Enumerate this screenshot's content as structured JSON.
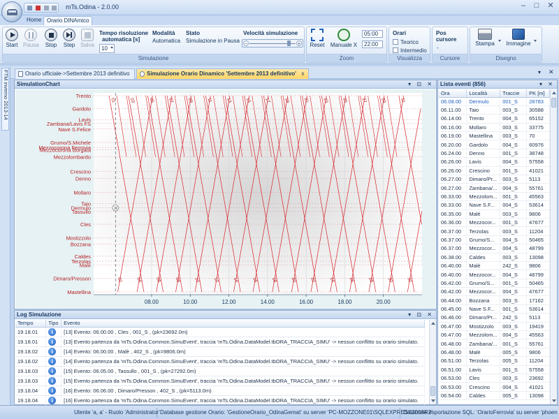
{
  "window": {
    "title": "mTs.Odina - 2.0.00",
    "minimize": "–",
    "maximize": "□",
    "close": "✕"
  },
  "ribbon_tabs": [
    {
      "label": "Home"
    },
    {
      "label": "Orario DINAmico"
    }
  ],
  "ribbon": {
    "simulazione": {
      "title": "Simulazione",
      "start": "Start",
      "pausa": "Pausa",
      "stop": "Stop",
      "step": "Step",
      "salva": "Salva",
      "tempo_label_1": "Tempo risoluzione",
      "tempo_label_2": "automatica [s]",
      "tempo_value": "10",
      "modalita_label": "Modalità",
      "modalita_value": "Automatica",
      "stato_label": "Stato",
      "stato_value": "Simulazione in Pausa",
      "velocita_label": "Velocità simulazione"
    },
    "zoom": {
      "title": "Zoom",
      "reset": "Reset",
      "manuale": "Manuale X",
      "time_from": "05:00",
      "time_to": "22:00"
    },
    "visualizza": {
      "title": "Visualizza",
      "orari_label": "Orari",
      "teorico": "Teorico",
      "intermedio": "Intermedio"
    },
    "cursore": {
      "title": "Cursore",
      "pos_label": "Pos cursore",
      "pos_x": "-",
      "pos_y": "-"
    },
    "disegno": {
      "title": "Disegno",
      "stampa": "Stampa",
      "immagine": "Immagine"
    }
  },
  "side_panel": {
    "label": "FTM inverno 2013-14"
  },
  "doc_tabs": [
    {
      "label": "Orario ufficiale->Settembre 2013 definitivo"
    },
    {
      "label": "Simulazione Orario Dinamico 'Settembre 2013 definitivo'",
      "close": "x"
    }
  ],
  "chart_panel": {
    "title": "SimulationChart",
    "controls": "▾ ⊡ ✕"
  },
  "chart_data": {
    "type": "line",
    "x_ticks": [
      "08.00",
      "10.00",
      "12.00",
      "14.00",
      "16.00",
      "18.00",
      "20.00"
    ],
    "x_range": [
      "05.00",
      "22.00"
    ],
    "stations": [
      {
        "name": "Trento",
        "km": 0
      },
      {
        "name": "Gardolo",
        "km": 4
      },
      {
        "name": "Lavis",
        "km": 7.3
      },
      {
        "name": "Zambana/Lavis FS",
        "km": 8.5
      },
      {
        "name": "Nave S.Felice",
        "km": 10.2
      },
      {
        "name": "Grumo/S.Michele",
        "km": 14.3
      },
      {
        "name": "Mezzocorona Ferrovia",
        "km": 15.8
      },
      {
        "name": "Mezzocorona Borgata",
        "km": 16.6
      },
      {
        "name": "Mezzolombardo",
        "km": 18.7
      },
      {
        "name": "Crescino",
        "km": 23.2
      },
      {
        "name": "Denno",
        "km": 25.3
      },
      {
        "name": "Mollaro",
        "km": 29.6
      },
      {
        "name": "Taio",
        "km": 33.0
      },
      {
        "name": "Dermulo",
        "km": 34.3
      },
      {
        "name": "Tassullo",
        "km": 35.4
      },
      {
        "name": "Cles",
        "km": 39.3
      },
      {
        "name": "Mostizzolo",
        "km": 43.5
      },
      {
        "name": "Bozzana",
        "km": 45.4
      },
      {
        "name": "Caldes",
        "km": 49.1
      },
      {
        "name": "Terzolas",
        "km": 50.6
      },
      {
        "name": "Malè",
        "km": 51.8
      },
      {
        "name": "Dimaro/Presson",
        "km": 55.8
      },
      {
        "name": "Mastellina",
        "km": 60.0
      }
    ],
    "cursor_time": "06.08",
    "legend": "none",
    "grid": true
  },
  "log_panel": {
    "title": "Log Simulazione",
    "controls": "▾ ⊡ ✕",
    "columns": [
      "Tempo",
      "Tipo",
      "Evento"
    ],
    "rows": [
      {
        "time": "19.18.01",
        "event": "[13] Evento: 06.00.00 , Cles , 001_S , (pk=23692.0m)"
      },
      {
        "time": "19.18.01",
        "event": "[13] Evento partenza da 'mTs.Odina.Common.SimuEvent', traccia 'mTs.Odina.DataModel.tbORA_TRACCIA_SIMU' -> nessun conflitto su orario simulato."
      },
      {
        "time": "19.18.02",
        "event": "[14] Evento: 06.00.00 , Malè , 402_S , (pk=9806.0m)"
      },
      {
        "time": "19.18.02",
        "event": "[14] Evento partenza da 'mTs.Odina.Common.SimuEvent', traccia 'mTs.Odina.DataModel.tbORA_TRACCIA_SIMU' -> nessun conflitto su orario simulato."
      },
      {
        "time": "19.18.03",
        "event": "[15] Evento: 06.05.00 , Tassullo , 001_S , (pk=27292.0m)"
      },
      {
        "time": "19.18.03",
        "event": "[15] Evento partenza da 'mTs.Odina.Common.SimuEvent', traccia 'mTs.Odina.DataModel.tbORA_TRACCIA_SIMU' -> nessun conflitto su orario simulato."
      },
      {
        "time": "19.18.04",
        "event": "[16] Evento: 06.06.00 , Dimaro/Presson , 402_S , (pk=5113.0m)"
      },
      {
        "time": "19.18.04",
        "event": "[16] Evento partenza da 'mTs.Odina.Common.SimuEvent', traccia 'mTs.Odina.DataModel.tbORA_TRACCIA_SIMU' -> nessun conflitto su orario simulato."
      }
    ]
  },
  "events_panel": {
    "title": "Lista eventi (856)",
    "controls": "▾ ✕",
    "columns": [
      "Ora",
      "Località",
      "Traccie",
      "PK [m]"
    ],
    "rows": [
      [
        "06.08.00",
        "Dermulo",
        "001_S",
        "28783"
      ],
      [
        "06.11.00",
        "Taio",
        "003_S",
        "30588"
      ],
      [
        "06.14.00",
        "Trento",
        "004_S",
        "65152"
      ],
      [
        "06.16.00",
        "Mollaro",
        "003_S",
        "33775"
      ],
      [
        "06.19.00",
        "Mastellina",
        "003_S",
        "70"
      ],
      [
        "06.20.00",
        "Gardolo",
        "004_S",
        "60976"
      ],
      [
        "06.24.00",
        "Denno",
        "001_S",
        "38748"
      ],
      [
        "06.26.00",
        "Lavis",
        "004_S",
        "57558"
      ],
      [
        "06.26.00",
        "Crescino",
        "001_S",
        "41021"
      ],
      [
        "06.27.00",
        "Dimaro/Pr...",
        "003_S",
        "5113"
      ],
      [
        "06.27.00",
        "Zambana/...",
        "004_S",
        "55761"
      ],
      [
        "06.33.00",
        "Mezzolom...",
        "001_S",
        "45563"
      ],
      [
        "06.33.00",
        "Nave S.F...",
        "004_S",
        "53614"
      ],
      [
        "06.35.00",
        "Malè",
        "003_S",
        "9806"
      ],
      [
        "06.36.00",
        "Mezzocor...",
        "001_S",
        "47677"
      ],
      [
        "06.37.00",
        "Terzolas",
        "003_S",
        "11204"
      ],
      [
        "06.37.00",
        "Grumo/S...",
        "004_S",
        "50465"
      ],
      [
        "06.37.00",
        "Mezzocor...",
        "004_S",
        "48799"
      ],
      [
        "06.38.00",
        "Caldes",
        "003_S",
        "13098"
      ],
      [
        "06.40.00",
        "Malè",
        "242_S",
        "9806"
      ],
      [
        "06.40.00",
        "Mezzocor...",
        "004_S",
        "48799"
      ],
      [
        "06.42.00",
        "Grumo/S...",
        "001_S",
        "50465"
      ],
      [
        "06.42.00",
        "Mezzocor...",
        "004_S",
        "47677"
      ],
      [
        "06.44.00",
        "Bozzana",
        "003_S",
        "17162"
      ],
      [
        "06.45.00",
        "Nave S.F...",
        "001_S",
        "53614"
      ],
      [
        "06.46.00",
        "Dimaro/Pr...",
        "242_S",
        "5113"
      ],
      [
        "06.47.00",
        "Mostizzolo",
        "003_S",
        "19419"
      ],
      [
        "06.47.00",
        "Mezzolom...",
        "004_S",
        "45563"
      ],
      [
        "06.48.00",
        "Zambana/...",
        "001_S",
        "55761"
      ],
      [
        "06.48.00",
        "Malè",
        "005_S",
        "9806"
      ],
      [
        "06.51.00",
        "Terzolas",
        "005_S",
        "11204"
      ],
      [
        "06.51.00",
        "Lavis",
        "001_S",
        "57558"
      ],
      [
        "06.53.00",
        "Cles",
        "003_S",
        "23692"
      ],
      [
        "06.53.00",
        "Crescino",
        "004_S",
        "41021"
      ],
      [
        "06.54.00",
        "Caldes",
        "005_S",
        "13098"
      ]
    ]
  },
  "status_bar": {
    "utente": "Utente 'a, a' - Ruolo 'Administrator'",
    "db_gestione": "Database gestione Orario: 'GestioneOrario_OdinaGemat' su server 'PC-MOZZONE01\\SQLEXPRESS2008R2'",
    "db_esportazione": "Database esportazione SQL: 'OrarioFerrovia' su server 'phoenix'"
  }
}
